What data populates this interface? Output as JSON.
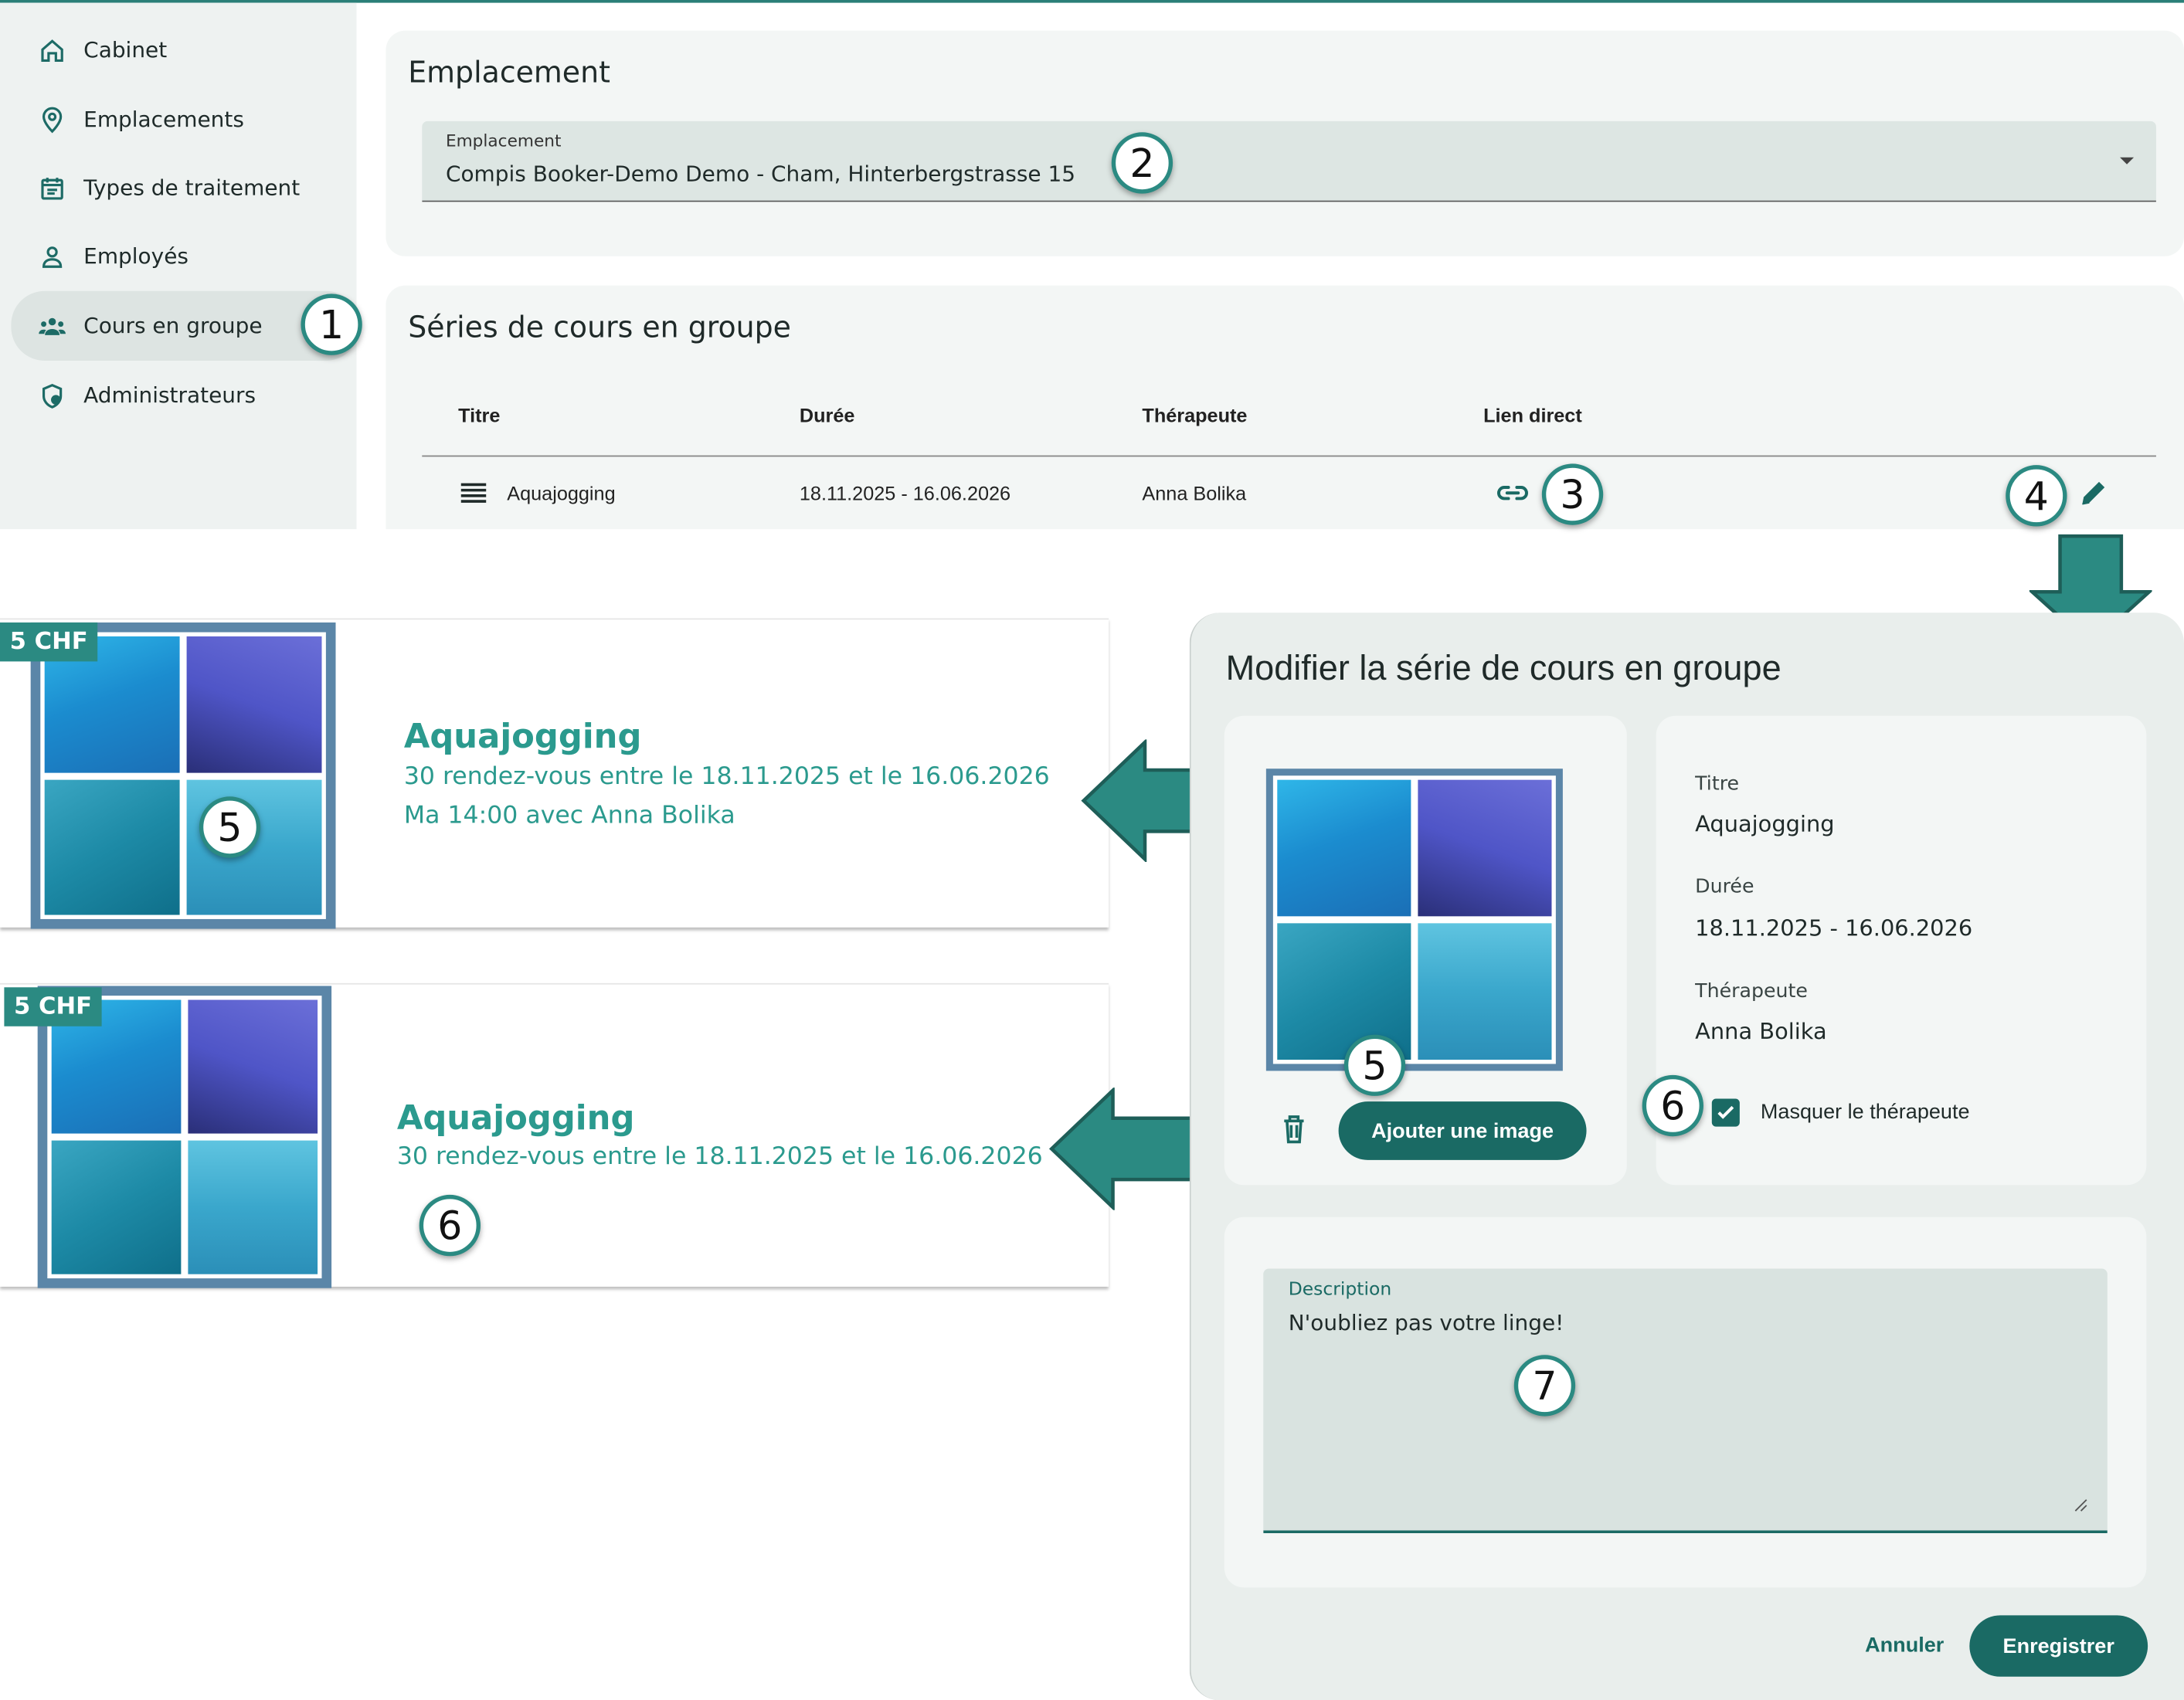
{
  "sidebar": {
    "items": [
      {
        "label": "Cabinet",
        "icon": "home-icon"
      },
      {
        "label": "Emplacements",
        "icon": "location-pin-icon"
      },
      {
        "label": "Types de traitement",
        "icon": "calendar-icon"
      },
      {
        "label": "Employés",
        "icon": "person-icon"
      },
      {
        "label": "Cours en groupe",
        "icon": "group-icon",
        "active": true
      },
      {
        "label": "Administrateurs",
        "icon": "shield-icon"
      }
    ]
  },
  "location_section": {
    "title": "Emplacement",
    "select_label": "Emplacement",
    "select_value": "Compis Booker-Demo Demo - Cham, Hinterbergstrasse 15"
  },
  "series_section": {
    "title": "Séries de cours en groupe",
    "columns": [
      "Titre",
      "Durée",
      "Thérapeute",
      "Lien direct"
    ],
    "rows": [
      {
        "title": "Aquajogging",
        "duration": "18.11.2025 - 16.06.2026",
        "therapist": "Anna Bolika"
      }
    ]
  },
  "badges": {
    "b1": "1",
    "b2": "2",
    "b3": "3",
    "b4": "4",
    "b5": "5",
    "b6": "6",
    "b7": "7"
  },
  "preview_cards": [
    {
      "price": "5 CHF",
      "title": "Aquajogging",
      "line1": "30 rendez-vous entre le 18.11.2025 et le 16.06.2026",
      "line2": "Ma 14:00 avec Anna Bolika"
    },
    {
      "price": "5 CHF",
      "title": "Aquajogging",
      "line1": "30 rendez-vous entre le 18.11.2025 et le 16.06.2026"
    }
  ],
  "dialog": {
    "title": "Modifier la série de cours en groupe",
    "add_image_label": "Ajouter une image",
    "fields": {
      "title_label": "Titre",
      "title_value": "Aquajogging",
      "duration_label": "Durée",
      "duration_value": "18.11.2025 - 16.06.2026",
      "therapist_label": "Thérapeute",
      "therapist_value": "Anna Bolika"
    },
    "hide_therapist_label": "Masquer le thérapeute",
    "hide_therapist_checked": true,
    "description_label": "Description",
    "description_value": "N'oubliez pas votre linge!",
    "cancel_label": "Annuler",
    "save_label": "Enregistrer"
  },
  "colors": {
    "accent": "#1a6a64",
    "teal_text": "#2b9a8e",
    "badge_border": "#2b8a82"
  }
}
